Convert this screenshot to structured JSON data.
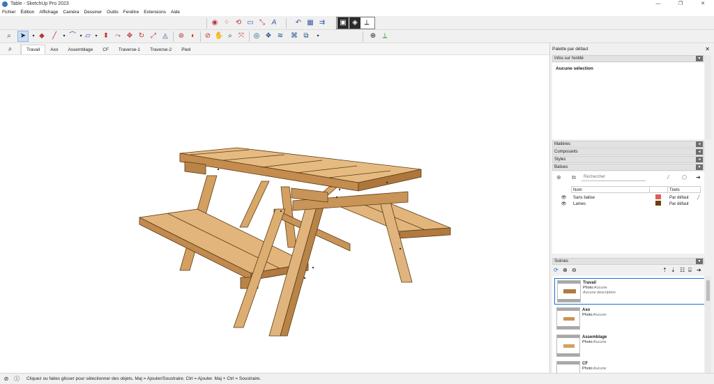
{
  "window": {
    "title": "Table - SketchUp Pro 2023",
    "controls": [
      "—",
      "❐",
      "✕"
    ]
  },
  "menu": [
    "Fichier",
    "Édition",
    "Affichage",
    "Caméra",
    "Dessiner",
    "Outils",
    "Fenêtre",
    "Extensions",
    "Aide"
  ],
  "scene_tabs": [
    "Travail",
    "Axo",
    "Assemblage",
    "CF",
    "Traverse-1",
    "Traverse-2",
    "Pied"
  ],
  "active_tab": "Travail",
  "status": {
    "text": "Cliquez ou faites glisser pour sélectionner des objets. Maj = Ajouter/Soustraire. Ctrl = Ajouter. Maj + Ctrl = Soustraire."
  },
  "palette": {
    "title": "Palette par défaut",
    "panels": {
      "entity_info": {
        "label": "Infos sur l'entité",
        "selection": "Aucune sélection"
      },
      "materials": {
        "label": "Matières"
      },
      "components": {
        "label": "Composants"
      },
      "styles": {
        "label": "Styles"
      },
      "tags": {
        "label": "Balises",
        "search_placeholder": "Rechercher",
        "col_name": "Nom",
        "col_dashes": "Tirets",
        "rows": [
          {
            "name": "Sans balise",
            "color": "#e05a5a",
            "dash": "Par défaut"
          },
          {
            "name": "Lames",
            "color": "#6b3f10",
            "dash": "Par défaut"
          }
        ]
      },
      "scenes": {
        "label": "Scènes",
        "items": [
          {
            "name": "Travail",
            "photo_label": "Photo:",
            "photo": "Aucune",
            "desc": "Aucune description"
          },
          {
            "name": "Axo",
            "photo_label": "Photo:",
            "photo": "Aucune",
            "desc": ""
          },
          {
            "name": "Assemblage",
            "photo_label": "Photo:",
            "photo": "Aucune",
            "desc": ""
          },
          {
            "name": "CF",
            "photo_label": "Photo:",
            "photo": "Aucune",
            "desc": ""
          }
        ]
      }
    }
  },
  "colors": {
    "wood_top": "#e0b47c",
    "wood_side": "#c99458",
    "wood_dark": "#a87236",
    "accent": "#1f6fd1"
  }
}
